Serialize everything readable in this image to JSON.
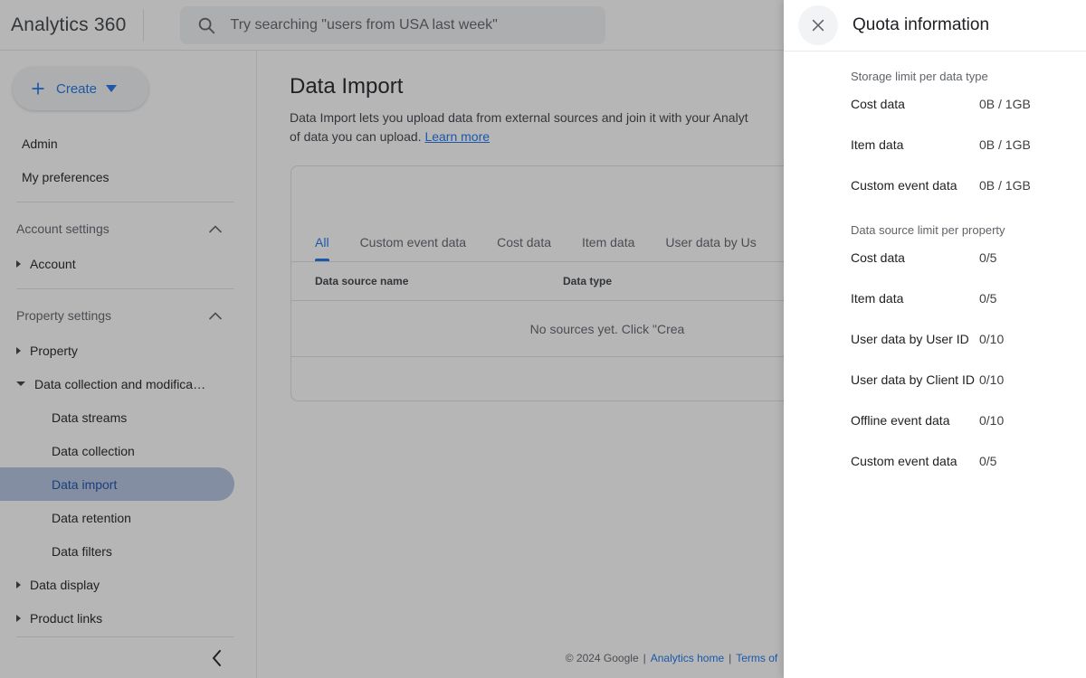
{
  "topbar": {
    "brand": "Analytics 360",
    "search_placeholder": "Try searching \"users from USA last week\"",
    "search_icon": "search-icon"
  },
  "sidebar": {
    "create_label": "Create",
    "plus_icon": "plus-icon",
    "caret_icon": "chevron-down-icon",
    "collapse_icon": "chevron-left-icon",
    "items": [
      {
        "label": "Admin",
        "level": "top"
      },
      {
        "label": "My preferences",
        "level": "top"
      },
      {
        "label": "Account settings",
        "level": "group",
        "expand_icon": "chevron-up-icon"
      },
      {
        "label": "Account",
        "level": "l1",
        "twisty": "triangle-right-icon"
      },
      {
        "label": "Property settings",
        "level": "group",
        "expand_icon": "chevron-up-icon"
      },
      {
        "label": "Property",
        "level": "l1",
        "twisty": "triangle-right-icon"
      },
      {
        "label": "Data collection and modifica…",
        "level": "l1",
        "twisty": "triangle-down-icon"
      },
      {
        "label": "Data streams",
        "level": "l2"
      },
      {
        "label": "Data collection",
        "level": "l2"
      },
      {
        "label": "Data import",
        "level": "l2",
        "selected": true
      },
      {
        "label": "Data retention",
        "level": "l2"
      },
      {
        "label": "Data filters",
        "level": "l2"
      },
      {
        "label": "Data display",
        "level": "l1",
        "twisty": "triangle-right-icon"
      },
      {
        "label": "Product links",
        "level": "l1",
        "twisty": "triangle-right-icon"
      }
    ]
  },
  "main": {
    "title": "Data Import",
    "description_part1": "Data Import lets you upload data from external sources and join it with your Analyt",
    "description_part2": "of data you can upload. ",
    "learn_more": "Learn more",
    "tabs": [
      {
        "label": "All",
        "active": true
      },
      {
        "label": "Custom event data",
        "active": false
      },
      {
        "label": "Cost data",
        "active": false
      },
      {
        "label": "Item data",
        "active": false
      },
      {
        "label": "User data by Us",
        "active": false
      }
    ],
    "table": {
      "columns": [
        "Data source name",
        "Data type"
      ],
      "empty_message": "No sources yet. Click \"Crea"
    }
  },
  "footer": {
    "copyright": "© 2024 Google",
    "link_home": "Analytics home",
    "link_terms": "Terms of",
    "separator": "|"
  },
  "panel": {
    "title": "Quota information",
    "close_icon": "close-icon",
    "sections": [
      {
        "label": "Storage limit per data type",
        "rows": [
          {
            "name": "Cost data",
            "value": "0B / 1GB"
          },
          {
            "name": "Item data",
            "value": "0B / 1GB"
          },
          {
            "name": "Custom event data",
            "value": "0B / 1GB"
          }
        ]
      },
      {
        "label": "Data source limit per property",
        "rows": [
          {
            "name": "Cost data",
            "value": "0/5"
          },
          {
            "name": "Item data",
            "value": "0/5"
          },
          {
            "name": "User data by User ID",
            "value": "0/10"
          },
          {
            "name": "User data by Client ID",
            "value": "0/10"
          },
          {
            "name": "Offline event data",
            "value": "0/10"
          },
          {
            "name": "Custom event data",
            "value": "0/5"
          }
        ]
      }
    ]
  },
  "colors": {
    "accent": "#1a73e8",
    "selected_nav_bg": "#b5c3e0",
    "selected_nav_text": "#174ea6",
    "text_primary": "#202124",
    "text_secondary": "#5f6368",
    "scrim": "rgba(32,33,36,0.33)"
  }
}
